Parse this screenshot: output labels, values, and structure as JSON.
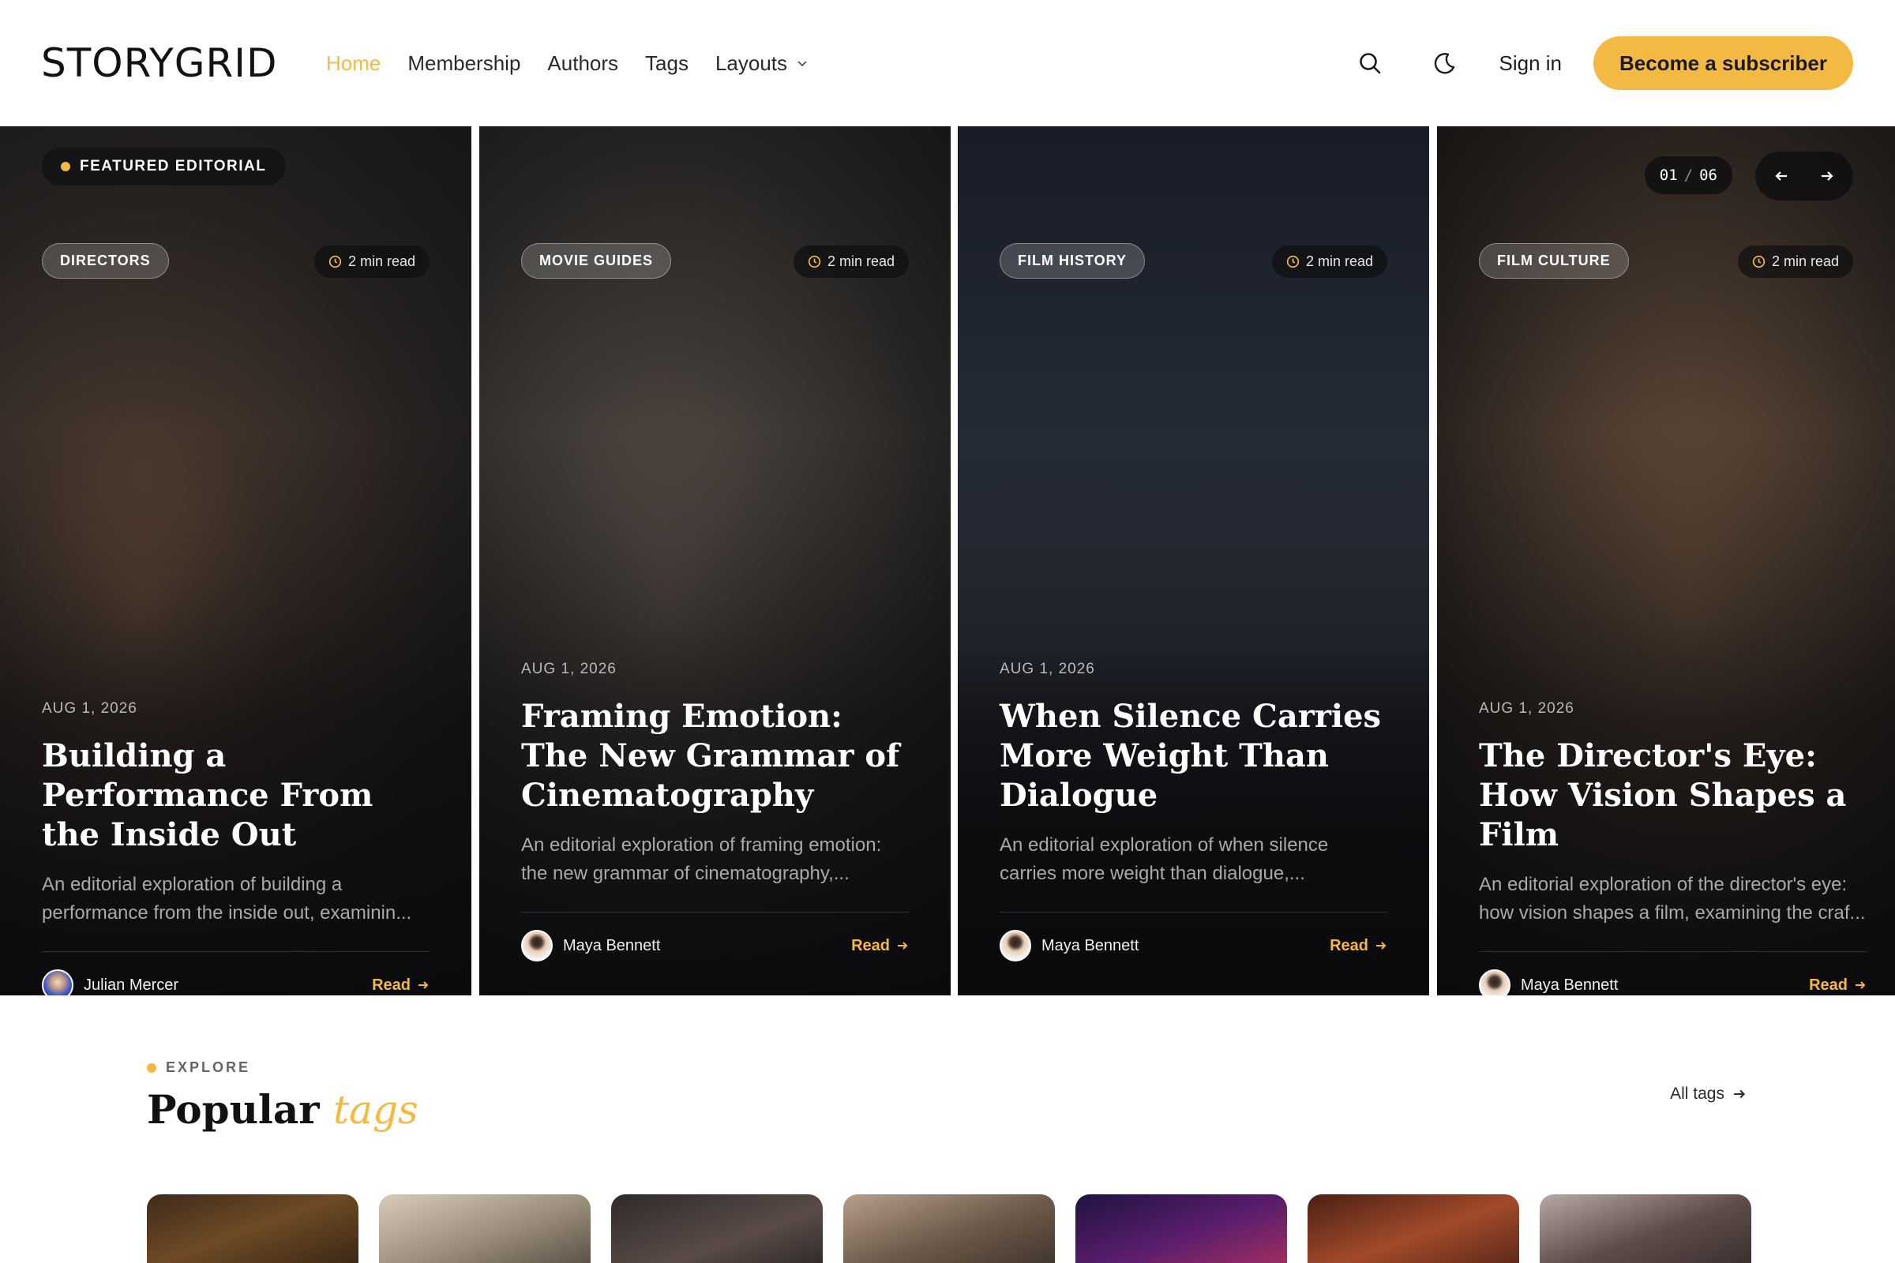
{
  "header": {
    "logo": "STORYGRID",
    "nav": [
      {
        "label": "Home",
        "active": true
      },
      {
        "label": "Membership"
      },
      {
        "label": "Authors"
      },
      {
        "label": "Tags"
      },
      {
        "label": "Layouts",
        "has_dropdown": true
      }
    ],
    "search_icon": "search-icon",
    "theme_icon": "moon-icon",
    "signin_label": "Sign in",
    "subscribe_label": "Become a subscriber"
  },
  "colors": {
    "accent": "#f4b942",
    "text_dark": "#111111",
    "card_overlay": "#0a0a0c"
  },
  "featured_badge": "FEATURED EDITORIAL",
  "carousel": {
    "current": "01",
    "total": "06",
    "separator": "/",
    "prev_icon": "arrow-left-icon",
    "next_icon": "arrow-right-icon"
  },
  "cards": [
    {
      "category": "DIRECTORS",
      "read_time": "2 min read",
      "date": "AUG 1, 2026",
      "title": "Building a Performance From the Inside Out",
      "excerpt": "An editorial exploration of building a performance from the inside out, examinin...",
      "author": "Julian Mercer",
      "read_label": "Read"
    },
    {
      "category": "MOVIE GUIDES",
      "read_time": "2 min read",
      "date": "AUG 1, 2026",
      "title": "Framing Emotion: The New Grammar of Cinematography",
      "excerpt": "An editorial exploration of framing emotion: the new grammar of cinematography,...",
      "author": "Maya Bennett",
      "read_label": "Read"
    },
    {
      "category": "FILM HISTORY",
      "read_time": "2 min read",
      "date": "AUG 1, 2026",
      "title": "When Silence Carries More Weight Than Dialogue",
      "excerpt": "An editorial exploration of when silence carries more weight than dialogue,...",
      "author": "Maya Bennett",
      "read_label": "Read"
    },
    {
      "category": "FILM CULTURE",
      "read_time": "2 min read",
      "date": "AUG 1, 2026",
      "title": "The Director's Eye: How Vision Shapes a Film",
      "excerpt": "An editorial exploration of the director's eye: how vision shapes a film, examining the craf...",
      "author": "Maya Bennett",
      "read_label": "Read"
    }
  ],
  "explore": {
    "eyebrow": "EXPLORE",
    "title_main": "Popular",
    "title_accent": "tags",
    "all_tags_label": "All tags"
  }
}
